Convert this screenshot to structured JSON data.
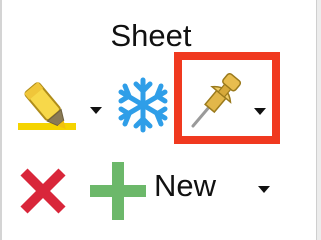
{
  "group": {
    "title": "Sheet"
  },
  "buttons": {
    "highlight": {
      "icon": "highlighter-icon",
      "has_dropdown": true
    },
    "freeze": {
      "icon": "snowflake-icon"
    },
    "pin": {
      "icon": "pushpin-icon",
      "has_dropdown": true,
      "selected": true
    },
    "delete": {
      "icon": "red-x-icon"
    },
    "add": {
      "icon": "green-plus-icon"
    },
    "new": {
      "label": "New",
      "has_dropdown": true
    }
  },
  "colors": {
    "highlight_frame": "#f0391f",
    "delete_red": "#d9263a",
    "add_green": "#6cb86a",
    "snowflake_blue": "#2f9ee8",
    "highlighter_yellow": "#f7d84a",
    "pin_gold": "#e8bd4f"
  }
}
